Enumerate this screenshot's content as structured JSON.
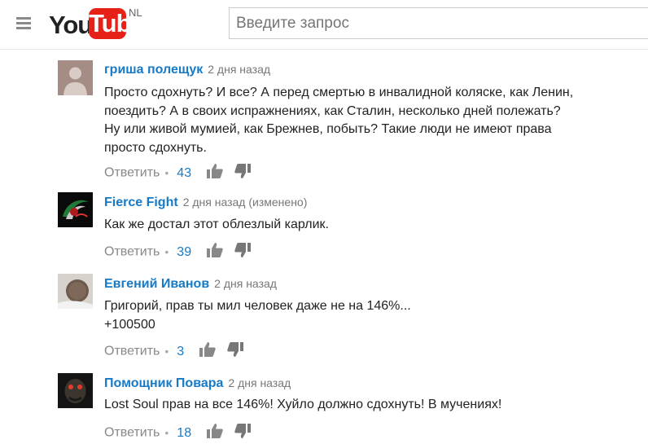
{
  "header": {
    "logo_you": "You",
    "logo_tube": "Tube",
    "logo_region": "NL",
    "search_placeholder": "Введите запрос"
  },
  "comments": [
    {
      "author": "гриша полещук",
      "time": "2 дня назад",
      "lines": [
        "Просто сдохнуть? И все? А перед смертью в инвалидной коляске, как Ленин,",
        "поездить? А в своих испражнениях, как Сталин, несколько дней полежать?",
        "Ну или живой мумией, как Брежнев, побыть? Такие люди  не имеют права",
        "просто сдохнуть."
      ],
      "reply": "Ответить",
      "likes": "43",
      "avatar": "default-avatar"
    },
    {
      "author": "Fierce Fight",
      "time": "2 дня назад (изменено)",
      "lines": [
        "Как же достал этот облезлый карлик."
      ],
      "reply": "Ответить",
      "likes": "39",
      "avatar": "fierce-fight-avatar"
    },
    {
      "author": "Евгений Иванов",
      "time": "2 дня назад",
      "lines": [
        "Григорий, прав ты мил человек даже не на 146%...",
        "+100500"
      ],
      "reply": "Ответить",
      "likes": "3",
      "avatar": "coin-avatar"
    },
    {
      "author": "Помощник Повара",
      "time": "2 дня назад",
      "lines": [
        "Lost Soul  прав на все 146%! Хуйло должно сдохнуть! В мучениях!"
      ],
      "reply": "Ответить",
      "likes": "18",
      "avatar": "creature-avatar"
    }
  ],
  "icons": {
    "menu": "hamburger-menu-icon",
    "like": "thumbs-up-icon",
    "dislike": "thumbs-down-icon"
  },
  "colors": {
    "author": "#167ac6",
    "likes": "#167ac6",
    "brand_red": "#e62117",
    "muted": "#888888"
  }
}
